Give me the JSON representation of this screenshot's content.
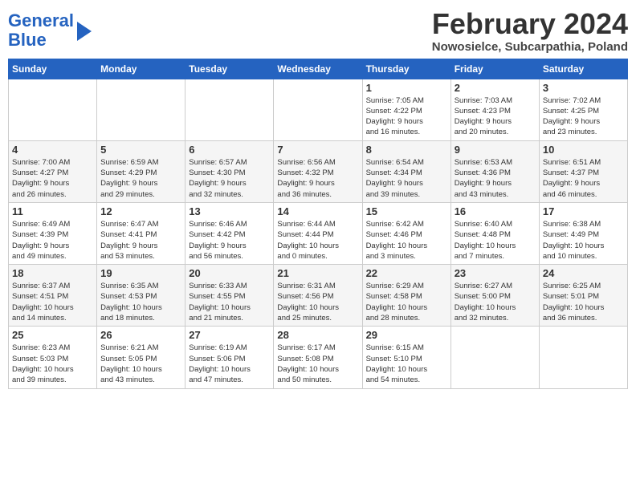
{
  "header": {
    "logo_line1": "General",
    "logo_line2": "Blue",
    "month_title": "February 2024",
    "subtitle": "Nowosielce, Subcarpathia, Poland"
  },
  "days_of_week": [
    "Sunday",
    "Monday",
    "Tuesday",
    "Wednesday",
    "Thursday",
    "Friday",
    "Saturday"
  ],
  "weeks": [
    [
      {
        "day": "",
        "detail": ""
      },
      {
        "day": "",
        "detail": ""
      },
      {
        "day": "",
        "detail": ""
      },
      {
        "day": "",
        "detail": ""
      },
      {
        "day": "1",
        "detail": "Sunrise: 7:05 AM\nSunset: 4:22 PM\nDaylight: 9 hours\nand 16 minutes."
      },
      {
        "day": "2",
        "detail": "Sunrise: 7:03 AM\nSunset: 4:23 PM\nDaylight: 9 hours\nand 20 minutes."
      },
      {
        "day": "3",
        "detail": "Sunrise: 7:02 AM\nSunset: 4:25 PM\nDaylight: 9 hours\nand 23 minutes."
      }
    ],
    [
      {
        "day": "4",
        "detail": "Sunrise: 7:00 AM\nSunset: 4:27 PM\nDaylight: 9 hours\nand 26 minutes."
      },
      {
        "day": "5",
        "detail": "Sunrise: 6:59 AM\nSunset: 4:29 PM\nDaylight: 9 hours\nand 29 minutes."
      },
      {
        "day": "6",
        "detail": "Sunrise: 6:57 AM\nSunset: 4:30 PM\nDaylight: 9 hours\nand 32 minutes."
      },
      {
        "day": "7",
        "detail": "Sunrise: 6:56 AM\nSunset: 4:32 PM\nDaylight: 9 hours\nand 36 minutes."
      },
      {
        "day": "8",
        "detail": "Sunrise: 6:54 AM\nSunset: 4:34 PM\nDaylight: 9 hours\nand 39 minutes."
      },
      {
        "day": "9",
        "detail": "Sunrise: 6:53 AM\nSunset: 4:36 PM\nDaylight: 9 hours\nand 43 minutes."
      },
      {
        "day": "10",
        "detail": "Sunrise: 6:51 AM\nSunset: 4:37 PM\nDaylight: 9 hours\nand 46 minutes."
      }
    ],
    [
      {
        "day": "11",
        "detail": "Sunrise: 6:49 AM\nSunset: 4:39 PM\nDaylight: 9 hours\nand 49 minutes."
      },
      {
        "day": "12",
        "detail": "Sunrise: 6:47 AM\nSunset: 4:41 PM\nDaylight: 9 hours\nand 53 minutes."
      },
      {
        "day": "13",
        "detail": "Sunrise: 6:46 AM\nSunset: 4:42 PM\nDaylight: 9 hours\nand 56 minutes."
      },
      {
        "day": "14",
        "detail": "Sunrise: 6:44 AM\nSunset: 4:44 PM\nDaylight: 10 hours\nand 0 minutes."
      },
      {
        "day": "15",
        "detail": "Sunrise: 6:42 AM\nSunset: 4:46 PM\nDaylight: 10 hours\nand 3 minutes."
      },
      {
        "day": "16",
        "detail": "Sunrise: 6:40 AM\nSunset: 4:48 PM\nDaylight: 10 hours\nand 7 minutes."
      },
      {
        "day": "17",
        "detail": "Sunrise: 6:38 AM\nSunset: 4:49 PM\nDaylight: 10 hours\nand 10 minutes."
      }
    ],
    [
      {
        "day": "18",
        "detail": "Sunrise: 6:37 AM\nSunset: 4:51 PM\nDaylight: 10 hours\nand 14 minutes."
      },
      {
        "day": "19",
        "detail": "Sunrise: 6:35 AM\nSunset: 4:53 PM\nDaylight: 10 hours\nand 18 minutes."
      },
      {
        "day": "20",
        "detail": "Sunrise: 6:33 AM\nSunset: 4:55 PM\nDaylight: 10 hours\nand 21 minutes."
      },
      {
        "day": "21",
        "detail": "Sunrise: 6:31 AM\nSunset: 4:56 PM\nDaylight: 10 hours\nand 25 minutes."
      },
      {
        "day": "22",
        "detail": "Sunrise: 6:29 AM\nSunset: 4:58 PM\nDaylight: 10 hours\nand 28 minutes."
      },
      {
        "day": "23",
        "detail": "Sunrise: 6:27 AM\nSunset: 5:00 PM\nDaylight: 10 hours\nand 32 minutes."
      },
      {
        "day": "24",
        "detail": "Sunrise: 6:25 AM\nSunset: 5:01 PM\nDaylight: 10 hours\nand 36 minutes."
      }
    ],
    [
      {
        "day": "25",
        "detail": "Sunrise: 6:23 AM\nSunset: 5:03 PM\nDaylight: 10 hours\nand 39 minutes."
      },
      {
        "day": "26",
        "detail": "Sunrise: 6:21 AM\nSunset: 5:05 PM\nDaylight: 10 hours\nand 43 minutes."
      },
      {
        "day": "27",
        "detail": "Sunrise: 6:19 AM\nSunset: 5:06 PM\nDaylight: 10 hours\nand 47 minutes."
      },
      {
        "day": "28",
        "detail": "Sunrise: 6:17 AM\nSunset: 5:08 PM\nDaylight: 10 hours\nand 50 minutes."
      },
      {
        "day": "29",
        "detail": "Sunrise: 6:15 AM\nSunset: 5:10 PM\nDaylight: 10 hours\nand 54 minutes."
      },
      {
        "day": "",
        "detail": ""
      },
      {
        "day": "",
        "detail": ""
      }
    ]
  ]
}
